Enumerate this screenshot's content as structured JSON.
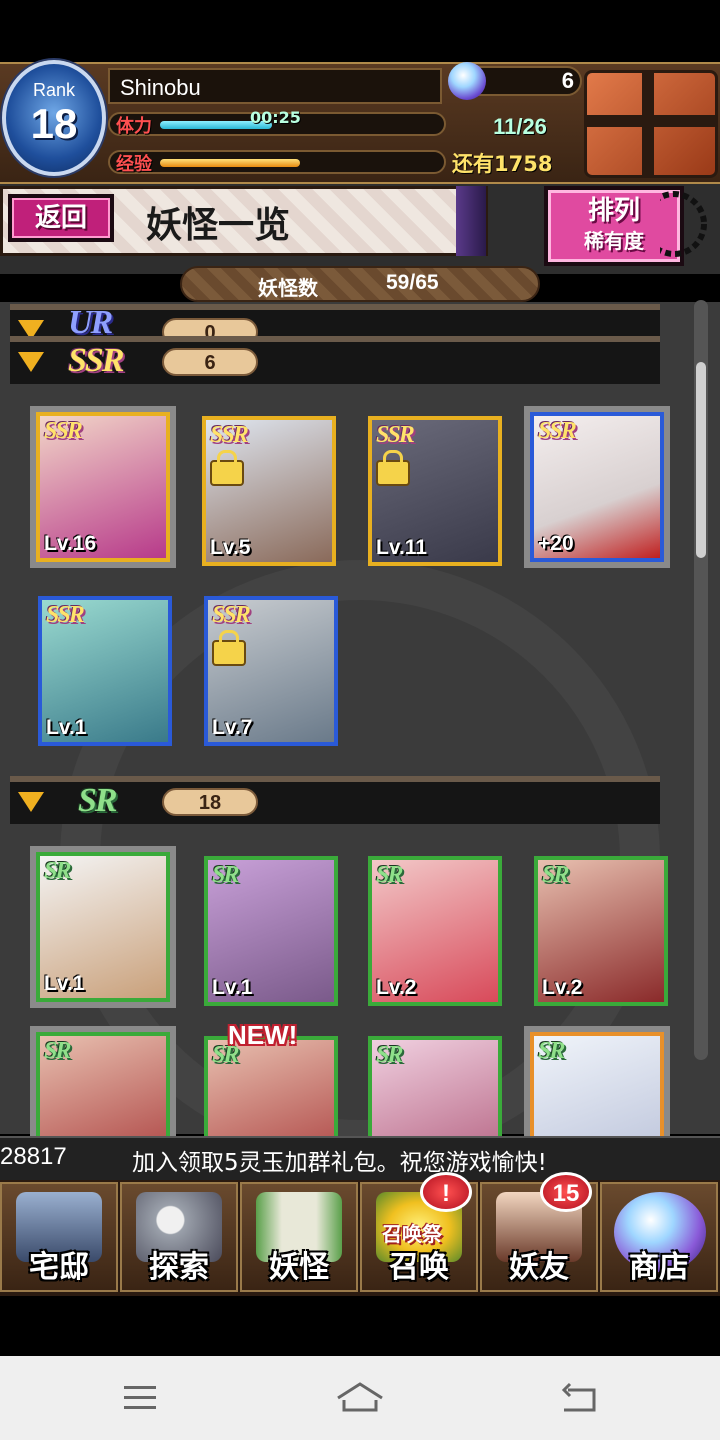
{
  "header": {
    "rank_label": "Rank",
    "rank_value": "18",
    "player_name": "Shinobu",
    "stamina_label": "体力",
    "stamina_timer": "00:25",
    "stamina_count": "11/26",
    "stamina_fill": 0.4,
    "exp_label": "经验",
    "exp_remaining": "还有1758",
    "exp_fill": 0.5,
    "gem_count": "6"
  },
  "title_bar": {
    "back_label": "返回",
    "title": "妖怪一览",
    "sort_label_1": "排列",
    "sort_label_2": "稀有度"
  },
  "count_pill": {
    "label": "妖怪数",
    "value": "59/65"
  },
  "sections": {
    "ur": {
      "logo": "UR",
      "count": "0"
    },
    "ssr": {
      "logo": "SSR",
      "count": "6"
    },
    "sr": {
      "logo": "SR",
      "count": "18"
    }
  },
  "cards": {
    "ssr": [
      {
        "tag": "SSR",
        "level": "Lv.16",
        "color": "#b73a8a"
      },
      {
        "tag": "SSR",
        "level": "Lv.5",
        "color": "#8a6a5a"
      },
      {
        "tag": "SSR",
        "level": "Lv.11",
        "color": "#3a3a4a"
      },
      {
        "tag": "SSR",
        "level": "+20",
        "color": "#d8d0d0"
      },
      {
        "tag": "SSR",
        "level": "Lv.1",
        "color": "#3a7a8a"
      },
      {
        "tag": "SSR",
        "level": "Lv.7",
        "color": "#6a7a8a"
      }
    ],
    "sr": [
      {
        "tag": "SR",
        "level": "Lv.1",
        "color": "#c9a07a"
      },
      {
        "tag": "SR",
        "level": "Lv.1",
        "color": "#7a5a8a"
      },
      {
        "tag": "SR",
        "level": "Lv.2",
        "color": "#d84a5a"
      },
      {
        "tag": "SR",
        "level": "Lv.2",
        "color": "#8a2a2a"
      },
      {
        "tag": "SR",
        "level": "",
        "color": "#a83a3a"
      },
      {
        "tag": "SR",
        "level": "",
        "color": "#a83a3a"
      },
      {
        "tag": "SR",
        "level": "",
        "color": "#b05a7a"
      },
      {
        "tag": "SR",
        "level": "",
        "color": "#b8c0d8"
      }
    ]
  },
  "new_badge": "NEW!",
  "ticker": {
    "number": "28817",
    "message": "加入领取5灵玉加群礼包。祝您游戏愉快!"
  },
  "nav": {
    "home": "宅邸",
    "explore": "探索",
    "yokai": "妖怪",
    "summon": "召唤",
    "summon_event": "召唤祭",
    "summon_badge": "!",
    "friends": "妖友",
    "friends_badge": "15",
    "shop": "商店"
  },
  "colors": {
    "ssr_frame": "#e8b020",
    "sr_frame": "#3aaa3a",
    "back_button": "#c0207a",
    "sort_button": "#e04aa0"
  }
}
